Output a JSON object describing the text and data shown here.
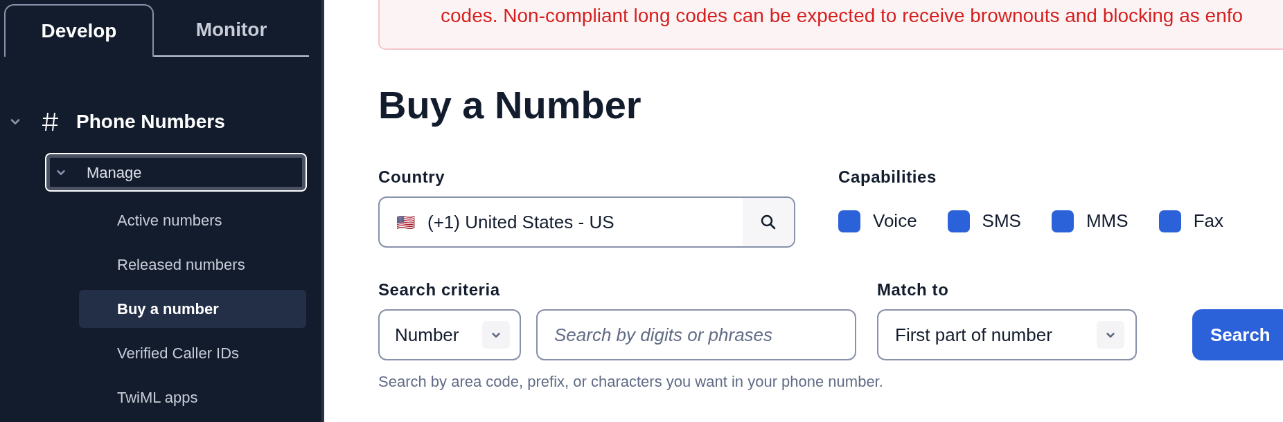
{
  "sidebar": {
    "tabs": [
      {
        "label": "Develop",
        "selected": true
      },
      {
        "label": "Monitor",
        "selected": false
      }
    ],
    "section": {
      "label": "Phone Numbers",
      "expanded": true,
      "children": [
        {
          "label": "Manage",
          "expanded": true,
          "focused": true,
          "children": [
            {
              "label": "Active numbers",
              "selected": false
            },
            {
              "label": "Released numbers",
              "selected": false
            },
            {
              "label": "Buy a number",
              "selected": true
            },
            {
              "label": "Verified Caller IDs",
              "selected": false
            },
            {
              "label": "TwiML apps",
              "selected": false
            }
          ]
        }
      ]
    }
  },
  "banner": {
    "text": "codes. Non-compliant long codes can be expected to receive brownouts and blocking as enfo"
  },
  "title": "Buy a Number",
  "country": {
    "label": "Country",
    "flag": "🇺🇸",
    "value": "(+1) United States - US"
  },
  "capabilities": {
    "label": "Capabilities",
    "options": [
      {
        "label": "Voice",
        "checked": true
      },
      {
        "label": "SMS",
        "checked": true
      },
      {
        "label": "MMS",
        "checked": true
      },
      {
        "label": "Fax",
        "checked": true
      }
    ]
  },
  "search_criteria": {
    "label": "Search criteria",
    "type_value": "Number",
    "placeholder": "Search by digits or phrases"
  },
  "match_to": {
    "label": "Match to",
    "value": "First part of number"
  },
  "search_button": "Search",
  "help_text": "Search by area code, prefix, or characters you want in your phone number."
}
